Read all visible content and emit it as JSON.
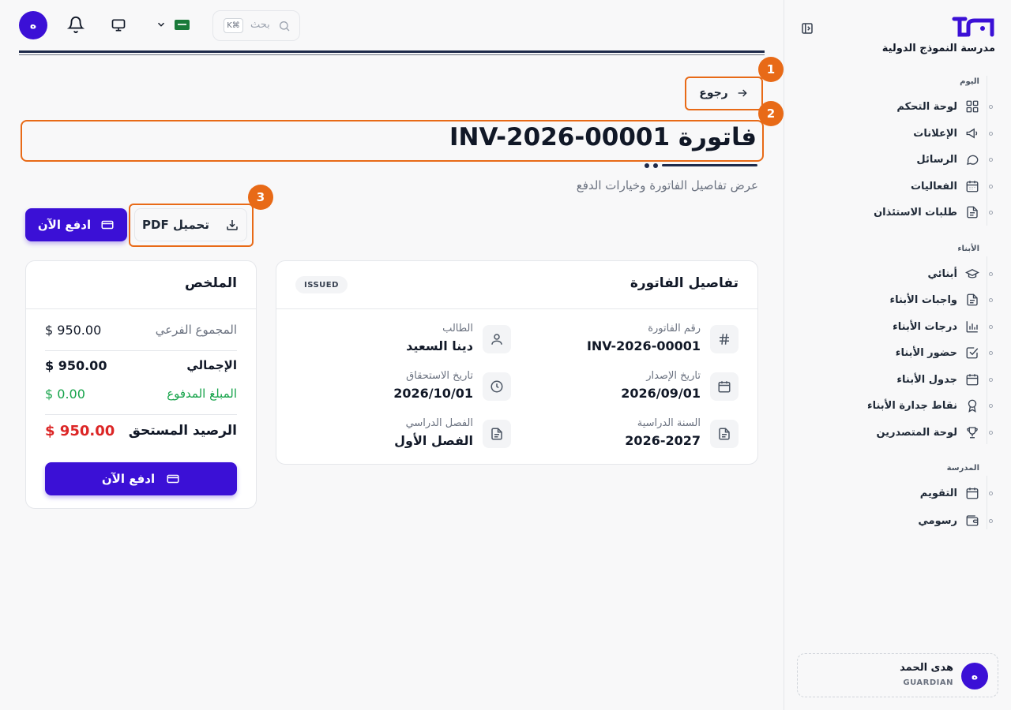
{
  "sidebar": {
    "school_name": "مدرسة النموذج الدولية",
    "sections": {
      "today": "اليوم",
      "children": "الأبناء",
      "school": "المدرسة"
    },
    "items": [
      {
        "label": "لوحة التحكم",
        "icon": "dashboard-icon"
      },
      {
        "label": "الإعلانات",
        "icon": "megaphone-icon"
      },
      {
        "label": "الرسائل",
        "icon": "message-icon"
      },
      {
        "label": "الفعاليات",
        "icon": "calendar-grid-icon"
      },
      {
        "label": "طلبات الاستئذان",
        "icon": "document-icon"
      },
      {
        "label": "أبنائي",
        "icon": "graduation-cap-icon"
      },
      {
        "label": "واجبات الأبناء",
        "icon": "document-icon"
      },
      {
        "label": "درجات الأبناء",
        "icon": "bar-chart-icon"
      },
      {
        "label": "حضور الأبناء",
        "icon": "check-square-icon"
      },
      {
        "label": "جدول الأبناء",
        "icon": "calendar-icon"
      },
      {
        "label": "نقاط جدارة الأبناء",
        "icon": "award-icon"
      },
      {
        "label": "لوحة المتصدرين",
        "icon": "trophy-icon"
      },
      {
        "label": "التقويم",
        "icon": "calendar-icon"
      },
      {
        "label": "رسومي",
        "icon": "wallet-icon"
      }
    ],
    "user": {
      "initial": "ه",
      "name": "هدى الحمد",
      "role": "GUARDIAN"
    }
  },
  "topbar": {
    "avatar_initial": "ه",
    "search_placeholder": "بحث",
    "search_shortcut": "K⌘"
  },
  "header": {
    "back_label": "رجوع",
    "title": "فاتورة INV-2026-00001",
    "subtitle": "عرض تفاصيل الفاتورة وخيارات الدفع",
    "pay_now_label": "ادفع الآن",
    "download_pdf_label": "تحميل PDF"
  },
  "annotations": [
    "1",
    "2",
    "3"
  ],
  "invoice": {
    "title": "تفاصيل الفاتورة",
    "status": "ISSUED",
    "fields": [
      {
        "label": "رقم الفاتورة",
        "value": "INV-2026-00001",
        "icon": "hash-icon"
      },
      {
        "label": "الطالب",
        "value": "دينا السعيد",
        "icon": "user-icon"
      },
      {
        "label": "تاريخ الإصدار",
        "value": "2026/09/01",
        "icon": "calendar-icon"
      },
      {
        "label": "تاريخ الاستحقاق",
        "value": "2026/10/01",
        "icon": "clock-icon"
      },
      {
        "label": "السنة الدراسية",
        "value": "2026-2027",
        "icon": "document-icon"
      },
      {
        "label": "الفصل الدراسي",
        "value": "الفصل الأول",
        "icon": "document-icon"
      }
    ]
  },
  "summary": {
    "title": "الملخص",
    "subtotal_label": "المجموع الفرعي",
    "subtotal_value": "$ 950.00",
    "total_label": "الإجمالي",
    "total_value": "$ 950.00",
    "paid_label": "المبلغ المدفوع",
    "paid_value": "$ 0.00",
    "balance_label": "الرصيد المستحق",
    "balance_value": "$ 950.00",
    "pay_label": "ادفع الآن"
  },
  "colors": {
    "primary": "#3b10d6",
    "annotation": "#e86a17",
    "paid": "#16a34a",
    "balance": "#dc2626"
  }
}
